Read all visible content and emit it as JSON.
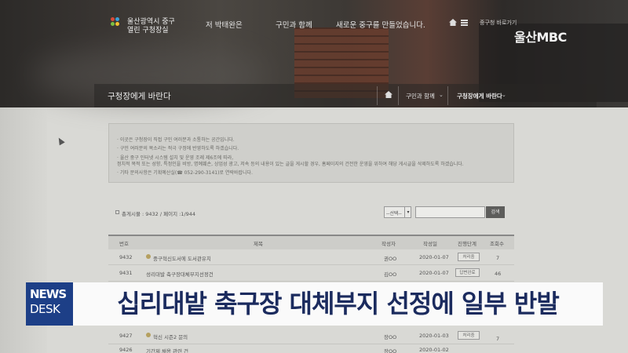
{
  "header": {
    "org_line1": "울산광역시 중구",
    "org_line2": "열린 구청장실",
    "nav": [
      "저 박태완은",
      "구민과 함께",
      "새로운 중구를 만들었습니다."
    ],
    "goto_label": "중구청 바로가기",
    "broadcaster": "울산MBC"
  },
  "subheader": {
    "title": "구청장에게 바란다",
    "crumb1": "구민과 함께",
    "crumb2": "구청장에게 바란다"
  },
  "notice": [
    "· 이곳은 구청장이 직접 구민 여러분과 소통하는 공간입니다.",
    "· 구민 여러분의 목소리는 적극 구정에 반영하도록 하겠습니다.",
    "· 울산 중구 인터넷 시스템 설치 및 운영 조례 제6조에 따라,",
    "  정치적 목적 또는 성향, 특정인을 비방, 명예훼손, 상업성 광고, 저속 등의 내용이 있는 글을 게시할 경우, 홈페이지의 건전한 운영을 위하여 해당 게시글을 삭제하도록 하겠습니다.",
    "· 기타 문의사항은 기획예산실(☎ 052-290-3141)로 연락바랍니다."
  ],
  "search": {
    "count_label": "총게시물 : 9432 / 페이지 :1/944",
    "select_value": "--선택--",
    "button_label": "검색"
  },
  "table": {
    "headers": [
      "번호",
      "제목",
      "작성자",
      "작성일",
      "진행단계",
      "조회수"
    ],
    "rows": [
      {
        "no": "9432",
        "title": "중구혁신도서에 도서관유치",
        "author": "권OO",
        "date": "2020-01-07",
        "status": "처리중",
        "views": "7"
      },
      {
        "no": "9431",
        "title": "성리대발 축구장대체부지선정건",
        "author": "김OO",
        "date": "2020-01-07",
        "status": "답변완료",
        "views": "46"
      },
      {
        "no": "9427",
        "title": "혁신 시즌2 문의",
        "author": "장OO",
        "date": "2020-01-03",
        "status": "처리중",
        "views": "7"
      },
      {
        "no": "9426",
        "title": "기간제 채용 관련 건",
        "author": "장OO",
        "date": "2020-01-02",
        "status": "",
        "views": ""
      }
    ]
  },
  "caption": {
    "badge_line1": "NEWS",
    "badge_line2": "DESK",
    "headline": "십리대밭 축구장 대체부지 선정에 일부 반발"
  },
  "colors": {
    "caption_text": "#1b2b5e",
    "badge_bg": "#1d3f87"
  }
}
